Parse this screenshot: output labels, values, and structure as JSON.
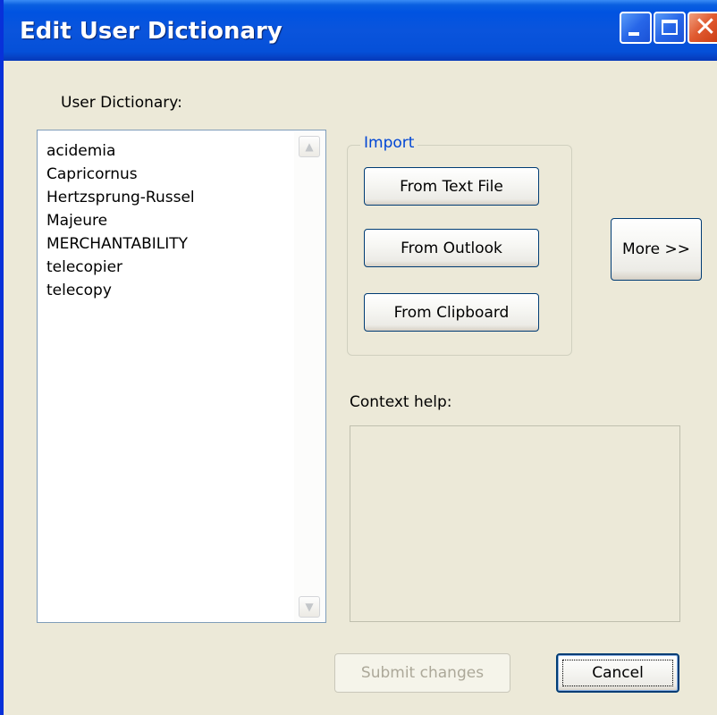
{
  "window": {
    "title": "Edit User Dictionary"
  },
  "titlebar_buttons": {
    "minimize_icon": "minimize-icon",
    "maximize_icon": "maximize-icon",
    "close_icon": "close-icon",
    "close_glyph": "✕"
  },
  "dictionary": {
    "label": "User Dictionary:",
    "words": [
      "acidemia",
      "Capricornus",
      "Hertzsprung-Russel",
      "Majeure",
      "MERCHANTABILITY",
      "telecopier",
      "telecopy"
    ],
    "scroll_up_glyph": "▲",
    "scroll_down_glyph": "▼"
  },
  "import": {
    "legend": "Import",
    "from_text_file": "From Text File",
    "from_outlook": "From Outlook",
    "from_clipboard": "From Clipboard"
  },
  "more_button": "More >>",
  "context_help": {
    "label": "Context help:",
    "text": ""
  },
  "footer": {
    "submit": "Submit changes",
    "cancel": "Cancel"
  },
  "colors": {
    "title_bar": "#0053e1",
    "window_bg": "#ece9d8",
    "group_legend": "#0046d5",
    "button_border": "#003c74"
  }
}
